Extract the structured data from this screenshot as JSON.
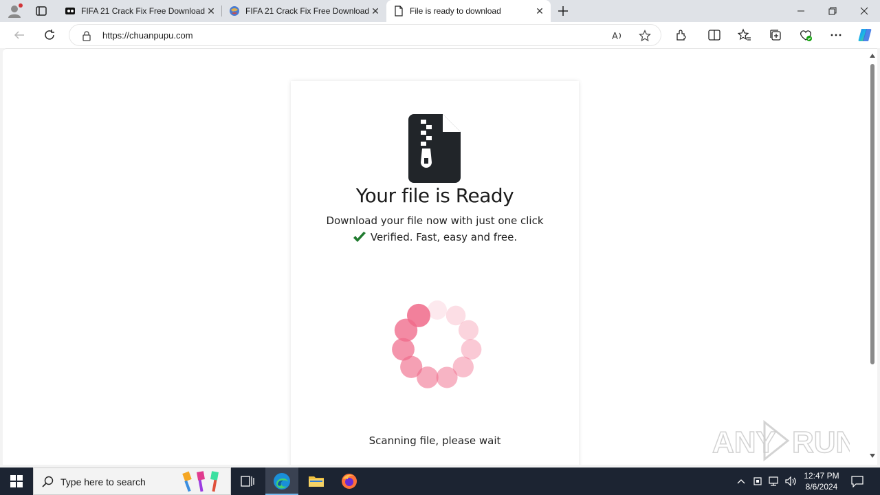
{
  "browser": {
    "tabs": [
      {
        "title": "FIFA 21 Crack Fix Free Download",
        "active": false,
        "favicon": "film-icon"
      },
      {
        "title": "FIFA 21 Crack Fix Free Download",
        "active": false,
        "favicon": "globe-icon"
      },
      {
        "title": "File is ready to download",
        "active": true,
        "favicon": "page-icon"
      }
    ],
    "address": "https://chuanpupu.com"
  },
  "page": {
    "heading": "Your file is Ready",
    "subheading": "Download your file now with just one click",
    "verified": "Verified. Fast, easy and free.",
    "status": "Scanning file, please wait",
    "spinner_color": "#f06a8a"
  },
  "taskbar": {
    "search_placeholder": "Type here to search",
    "time": "12:47 PM",
    "date": "8/6/2024"
  },
  "watermark": "ANY RUN"
}
